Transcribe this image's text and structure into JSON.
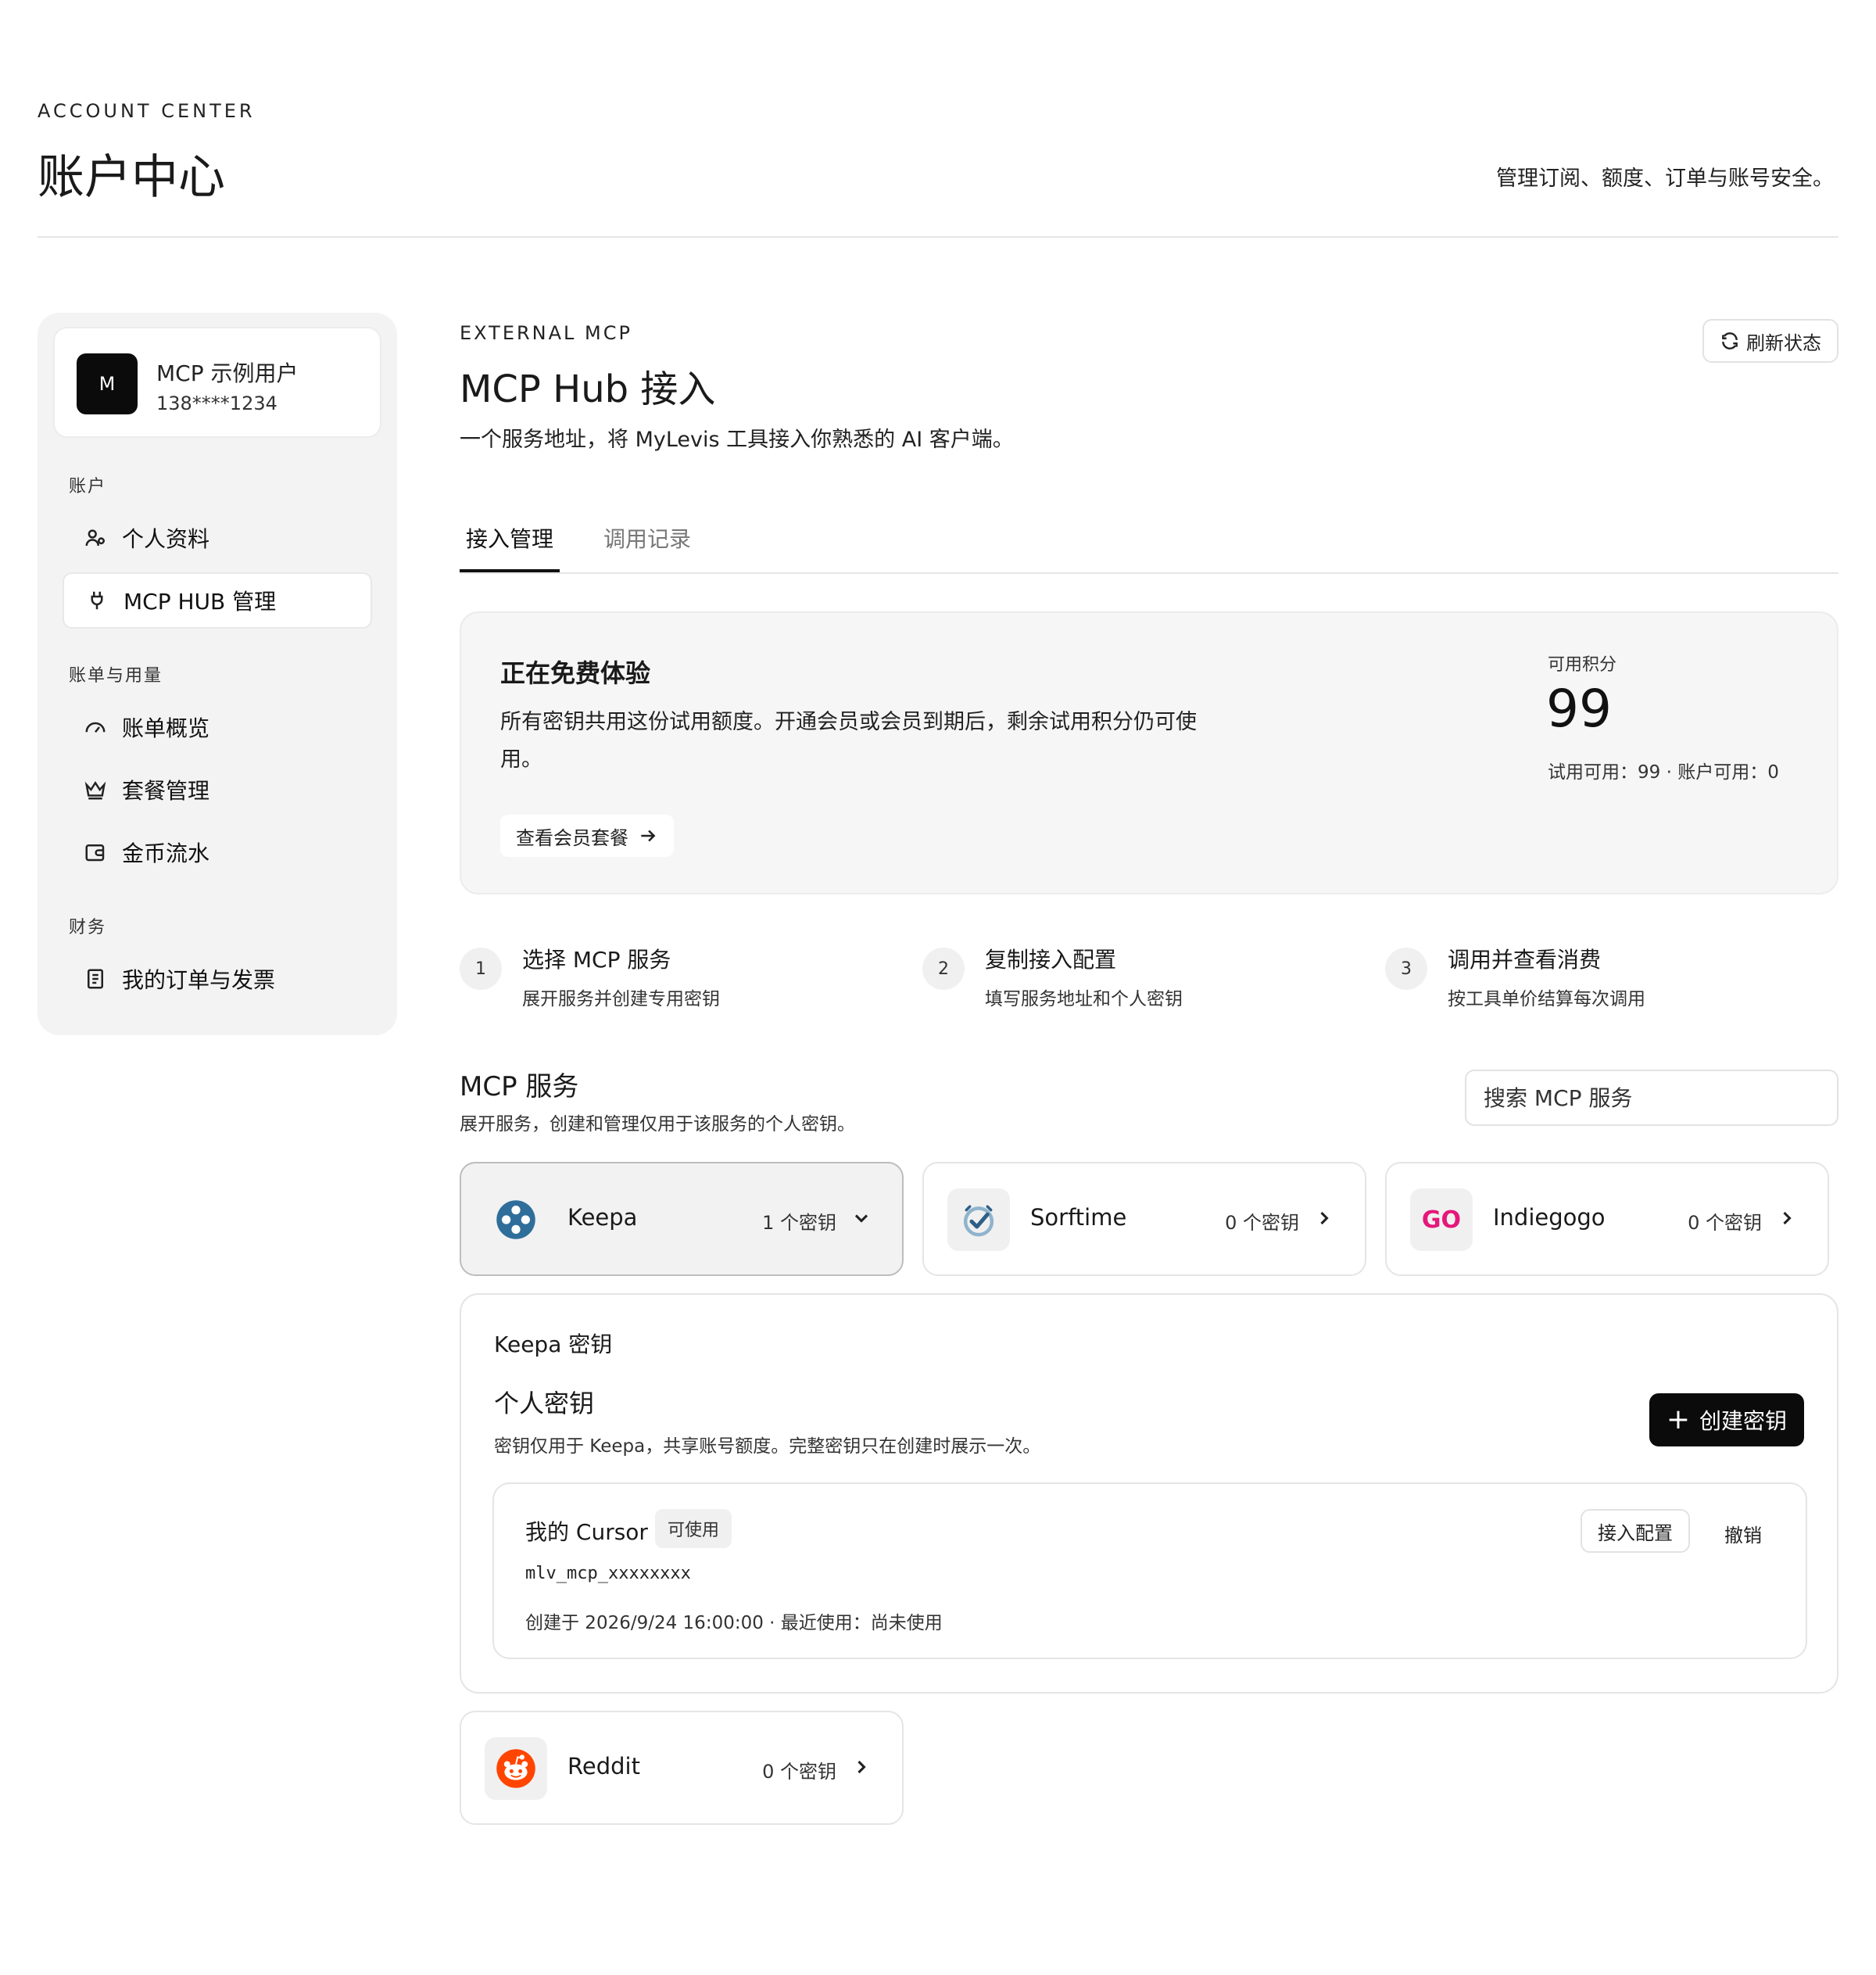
{
  "header": {
    "eyebrow": "ACCOUNT CENTER",
    "title": "账户中心",
    "subtitle": "管理订阅、额度、订单与账号安全。"
  },
  "sidebar": {
    "user": {
      "avatar_letter": "M",
      "name": "MCP 示例用户",
      "phone": "138****1234"
    },
    "sections": [
      {
        "label": "账户",
        "items": [
          {
            "label": "个人资料",
            "icon": "user-icon",
            "active": false
          },
          {
            "label": "MCP HUB 管理",
            "icon": "plug-icon",
            "active": true
          }
        ]
      },
      {
        "label": "账单与用量",
        "items": [
          {
            "label": "账单概览",
            "icon": "gauge-icon",
            "active": false
          },
          {
            "label": "套餐管理",
            "icon": "crown-icon",
            "active": false
          },
          {
            "label": "金币流水",
            "icon": "wallet-icon",
            "active": false
          }
        ]
      },
      {
        "label": "财务",
        "items": [
          {
            "label": "我的订单与发票",
            "icon": "receipt-icon",
            "active": false
          }
        ]
      }
    ]
  },
  "main": {
    "eyebrow": "EXTERNAL MCP",
    "title": "MCP Hub 接入",
    "description": "一个服务地址，将 MyLevis 工具接入你熟悉的 AI 客户端。",
    "refresh_label": "刷新状态",
    "tabs": [
      {
        "label": "接入管理",
        "active": true
      },
      {
        "label": "调用记录",
        "active": false
      }
    ],
    "trial": {
      "title": "正在免费体验",
      "description": "所有密钥共用这份试用额度。开通会员或会员到期后，剩余试用积分仍可使用。",
      "link_label": "查看会员套餐",
      "credit_label": "可用积分",
      "credit_value": "99",
      "credit_detail": "试用可用：99 · 账户可用：0"
    },
    "steps": [
      {
        "num": "1",
        "title": "选择 MCP 服务",
        "desc": "展开服务并创建专用密钥"
      },
      {
        "num": "2",
        "title": "复制接入配置",
        "desc": "填写服务地址和个人密钥"
      },
      {
        "num": "3",
        "title": "调用并查看消费",
        "desc": "按工具单价结算每次调用"
      }
    ],
    "services": {
      "title": "MCP 服务",
      "description": "展开服务，创建和管理仅用于该服务的个人密钥。",
      "search_placeholder": "搜索 MCP 服务",
      "items": [
        {
          "name": "Keepa",
          "count": "1 个密钥",
          "expanded": true,
          "logo": "keepa-logo"
        },
        {
          "name": "Sorftime",
          "count": "0 个密钥",
          "expanded": false,
          "logo": "sorftime-logo"
        },
        {
          "name": "Indiegogo",
          "count": "0 个密钥",
          "expanded": false,
          "logo": "indiegogo-logo",
          "logo_text": "GO"
        },
        {
          "name": "Reddit",
          "count": "0 个密钥",
          "expanded": false,
          "logo": "reddit-logo"
        }
      ]
    },
    "key_panel": {
      "title": "Keepa 密钥",
      "personal_title": "个人密钥",
      "personal_desc": "密钥仅用于 Keepa，共享账号额度。完整密钥只在创建时展示一次。",
      "create_label": "创建密钥",
      "keys": [
        {
          "name": "我的 Cursor",
          "status": "可使用",
          "value": "mlv_mcp_xxxxxxxx",
          "meta": "创建于 2026/9/24 16:00:00 · 最近使用：尚未使用",
          "config_label": "接入配置",
          "revoke_label": "撤销"
        }
      ]
    }
  },
  "colors": {
    "primary": "#0b0b0b",
    "sidebar_bg": "#f3f3f3",
    "card_bg": "#f6f6f6",
    "border": "#e5e5e5",
    "keepa_blue": "#2f6e9a",
    "indiegogo_pink": "#e5177a",
    "reddit_orange": "#ff4500"
  }
}
